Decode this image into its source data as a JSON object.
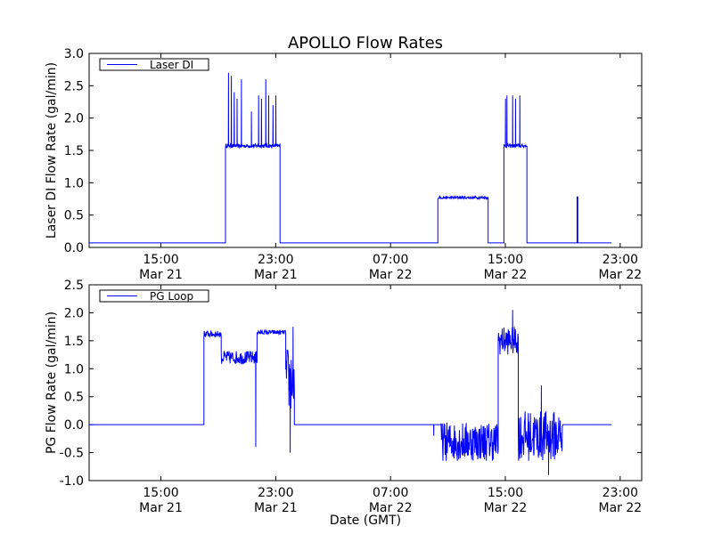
{
  "figure": {
    "title": "APOLLO Flow Rates",
    "xlabel": "Date (GMT)"
  },
  "chart_data": [
    {
      "type": "line",
      "title": "APOLLO Flow Rates",
      "ylabel": "Laser DI Flow Rate (gal/min)",
      "xlabel": "",
      "xlim": [
        9,
        33.5
      ],
      "ylim": [
        0,
        3.0
      ],
      "yticks": [
        0.0,
        0.5,
        1.0,
        1.5,
        2.0,
        2.5,
        3.0
      ],
      "ytick_labels": [
        "0.0",
        "0.5",
        "1.0",
        "1.5",
        "2.0",
        "2.5",
        "3.0"
      ],
      "xticks": [
        {
          "x": 14,
          "time": "15:00",
          "date": "Mar 21"
        },
        {
          "x": 22,
          "time": "23:00",
          "date": "Mar 21"
        },
        {
          "x": 30,
          "time": "07:00",
          "date": "Mar 22"
        },
        {
          "x": 38,
          "time": "15:00",
          "date": "Mar 22"
        },
        {
          "x": 46,
          "time": "23:00",
          "date": "Mar 22"
        }
      ],
      "grid": false,
      "legend_position": "top-left",
      "series": [
        {
          "name": "Laser DI",
          "color": "#0000ff",
          "segments": [
            {
              "x_start": 9.0,
              "x_end": 18.5,
              "value": 0.07,
              "noise": 0.0,
              "spikes": []
            },
            {
              "x_start": 18.5,
              "x_end": 22.3,
              "value": 1.57,
              "noise": 0.03,
              "spikes": [
                [
                  18.7,
                  2.7
                ],
                [
                  18.9,
                  2.65
                ],
                [
                  19.1,
                  2.4
                ],
                [
                  19.3,
                  2.3
                ],
                [
                  19.6,
                  2.6
                ],
                [
                  20.3,
                  2.1
                ],
                [
                  20.8,
                  2.35
                ],
                [
                  21.0,
                  2.3
                ],
                [
                  21.3,
                  2.6
                ],
                [
                  21.5,
                  2.35
                ],
                [
                  21.8,
                  2.2
                ],
                [
                  22.0,
                  2.35
                ]
              ]
            },
            {
              "x_start": 22.3,
              "x_end": 33.3,
              "value": 0.07,
              "noise": 0.0,
              "spikes": []
            },
            {
              "x_start": 33.3,
              "x_end": 36.8,
              "value": 0.77,
              "noise": 0.02,
              "spikes": []
            },
            {
              "x_start": 36.8,
              "x_end": 37.9,
              "value": 0.07,
              "noise": 0.0,
              "spikes": []
            },
            {
              "x_start": 37.9,
              "x_end": 39.5,
              "value": 1.57,
              "noise": 0.03,
              "spikes": [
                [
                  38.0,
                  2.3
                ],
                [
                  38.1,
                  2.35
                ],
                [
                  38.5,
                  2.35
                ],
                [
                  38.7,
                  2.3
                ],
                [
                  39.0,
                  2.35
                ]
              ]
            },
            {
              "x_start": 39.5,
              "x_end": 43.0,
              "value": 0.07,
              "noise": 0.0,
              "spikes": []
            },
            {
              "x_start": 43.0,
              "x_end": 43.05,
              "value": 0.78,
              "noise": 0.0,
              "spikes": []
            },
            {
              "x_start": 43.05,
              "x_end": 45.4,
              "value": 0.07,
              "noise": 0.0,
              "spikes": []
            }
          ]
        }
      ]
    },
    {
      "type": "line",
      "ylabel": "PG Flow Rate (gal/min)",
      "xlabel": "Date (GMT)",
      "xlim": [
        9,
        33.5
      ],
      "ylim": [
        -1.0,
        2.5
      ],
      "yticks": [
        -1.0,
        -0.5,
        0.0,
        0.5,
        1.0,
        1.5,
        2.0,
        2.5
      ],
      "ytick_labels": [
        "-1.0",
        "-0.5",
        "0.0",
        "0.5",
        "1.0",
        "1.5",
        "2.0",
        "2.5"
      ],
      "xticks": [
        {
          "x": 14,
          "time": "15:00",
          "date": "Mar 21"
        },
        {
          "x": 22,
          "time": "23:00",
          "date": "Mar 21"
        },
        {
          "x": 30,
          "time": "07:00",
          "date": "Mar 22"
        },
        {
          "x": 38,
          "time": "15:00",
          "date": "Mar 22"
        },
        {
          "x": 46,
          "time": "23:00",
          "date": "Mar 22"
        }
      ],
      "grid": false,
      "legend_position": "top-left",
      "series": [
        {
          "name": "PG Loop",
          "color": "#0000ff",
          "segments": [
            {
              "x_start": 9.0,
              "x_end": 17.0,
              "value": 0.0,
              "noise": 0.0,
              "spikes": []
            },
            {
              "x_start": 17.0,
              "x_end": 18.2,
              "value": 1.62,
              "noise": 0.06,
              "spikes": []
            },
            {
              "x_start": 18.2,
              "x_end": 20.7,
              "value": 1.2,
              "noise": 0.12,
              "spikes": [
                [
                  20.6,
                  -0.4
                ]
              ]
            },
            {
              "x_start": 20.7,
              "x_end": 22.7,
              "value": 1.65,
              "noise": 0.04,
              "spikes": []
            },
            {
              "x_start": 22.7,
              "x_end": 23.3,
              "value": 0.8,
              "noise": 0.6,
              "spikes": [
                [
                  23.0,
                  -0.5
                ],
                [
                  23.2,
                  1.75
                ]
              ]
            },
            {
              "x_start": 23.3,
              "x_end": 33.5,
              "value": 0.0,
              "noise": 0.0,
              "spikes": [
                [
                  33.0,
                  -0.2
                ]
              ]
            },
            {
              "x_start": 33.5,
              "x_end": 37.5,
              "value": -0.3,
              "noise": 0.35,
              "spikes": []
            },
            {
              "x_start": 37.5,
              "x_end": 38.9,
              "value": 1.5,
              "noise": 0.25,
              "spikes": [
                [
                  38.5,
                  2.05
                ]
              ]
            },
            {
              "x_start": 38.9,
              "x_end": 42.0,
              "value": -0.2,
              "noise": 0.45,
              "spikes": [
                [
                  40.5,
                  0.7
                ],
                [
                  41.0,
                  -0.9
                ]
              ]
            },
            {
              "x_start": 42.0,
              "x_end": 45.4,
              "value": 0.0,
              "noise": 0.0,
              "spikes": []
            }
          ]
        }
      ]
    }
  ]
}
